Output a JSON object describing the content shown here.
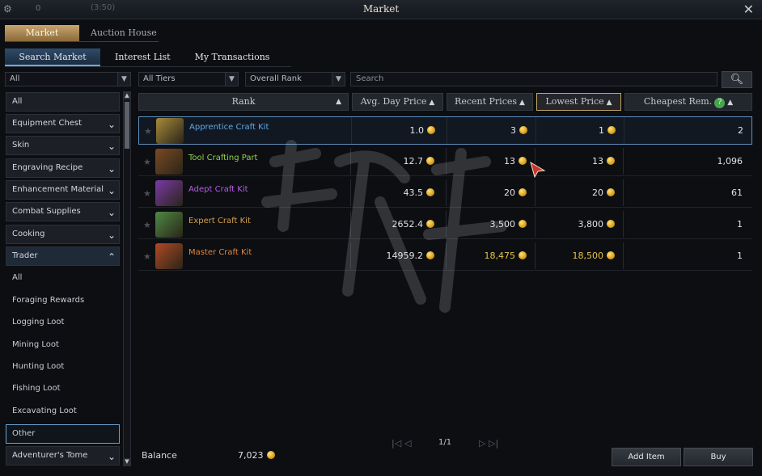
{
  "titlebar": {
    "title": "Market",
    "settings_icon": "gear-icon",
    "counter": "0",
    "clock": "(3:50)",
    "close_label": "✕"
  },
  "tabs_top": [
    {
      "label": "Market",
      "active": true
    },
    {
      "label": "Auction House",
      "active": false
    }
  ],
  "tabs_sub": [
    {
      "label": "Search Market",
      "active": true
    },
    {
      "label": "Interest List",
      "active": false
    },
    {
      "label": "My Transactions",
      "active": false
    }
  ],
  "filters": {
    "category": "All",
    "tier": "All Tiers",
    "rank": "Overall Rank",
    "search_placeholder": "Search"
  },
  "sidebar": {
    "categories": [
      {
        "label": "All",
        "expandable": false
      },
      {
        "label": "Equipment Chest",
        "expandable": true
      },
      {
        "label": "Skin",
        "expandable": true
      },
      {
        "label": "Engraving Recipe",
        "expandable": true
      },
      {
        "label": "Enhancement Material",
        "expandable": true
      },
      {
        "label": "Combat Supplies",
        "expandable": true
      },
      {
        "label": "Cooking",
        "expandable": true
      },
      {
        "label": "Trader",
        "expandable": true,
        "open": true
      }
    ],
    "trader_sub": [
      "All",
      "Foraging Rewards",
      "Logging Loot",
      "Mining Loot",
      "Hunting Loot",
      "Fishing Loot",
      "Excavating Loot",
      "Other"
    ],
    "selected_sub": "Other",
    "last_category": "Adventurer's Tome"
  },
  "table": {
    "headers": {
      "rank": "Rank",
      "avg": "Avg. Day Price",
      "recent": "Recent Prices",
      "lowest": "Lowest Price",
      "cheapest": "Cheapest Rem."
    },
    "rows": [
      {
        "name": "Apprentice Craft Kit",
        "name_color": "#5fa8e8",
        "icon_color": "#a78a3a",
        "avg": "1.0",
        "recent": "3",
        "lowest": "1",
        "cheapest": "2",
        "price_color": "#e2e4e8"
      },
      {
        "name": "Tool Crafting Part",
        "name_color": "#8fd34a",
        "icon_color": "#7a4a24",
        "avg": "12.7",
        "recent": "13",
        "lowest": "13",
        "cheapest": "1,096",
        "price_color": "#e2e4e8"
      },
      {
        "name": "Adept Craft Kit",
        "name_color": "#b65ee6",
        "icon_color": "#7a3aa8",
        "avg": "43.5",
        "recent": "20",
        "lowest": "20",
        "cheapest": "61",
        "price_color": "#e2e4e8"
      },
      {
        "name": "Expert Craft Kit",
        "name_color": "#d4a04a",
        "icon_color": "#4f8a44",
        "avg": "2652.4",
        "recent": "3,500",
        "lowest": "3,800",
        "cheapest": "1",
        "price_color": "#e2e4e8"
      },
      {
        "name": "Master Craft Kit",
        "name_color": "#e0843c",
        "icon_color": "#b04a24",
        "avg": "14959.2",
        "recent": "18,475",
        "lowest": "18,500",
        "cheapest": "1",
        "price_color": "#e8c34a"
      }
    ]
  },
  "pager": {
    "text": "1/1"
  },
  "footer": {
    "balance_label": "Balance",
    "balance": "7,023",
    "add_item": "Add Item",
    "buy": "Buy"
  }
}
